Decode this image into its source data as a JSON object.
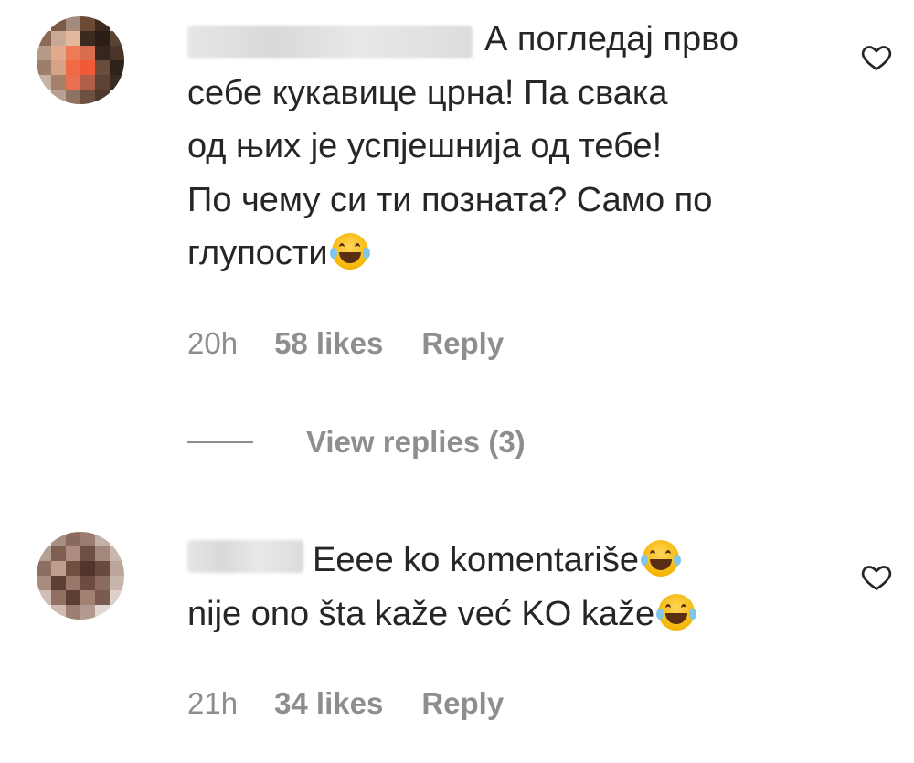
{
  "comments": [
    {
      "text_lines": [
        "А погледај прво",
        "себе кукавице црна! Па свака",
        "од њих је успјешнија од тебе!",
        "По чему си ти позната? Само по",
        "глупости"
      ],
      "username_suffix": "_",
      "time": "20h",
      "likes": "58 likes",
      "reply_label": "Reply",
      "view_replies_label": "View replies (3)"
    },
    {
      "text_lines": [
        "Eeee ko komentariše",
        "nije ono šta kaže već KO kaže"
      ],
      "time": "21h",
      "likes": "34 likes",
      "reply_label": "Reply"
    }
  ],
  "colors": {
    "text": "#262626",
    "secondary": "#8e8e8e",
    "emoji": "#f4b400"
  },
  "icons": [
    "heart-icon",
    "face-with-tears-of-joy-emoji"
  ]
}
